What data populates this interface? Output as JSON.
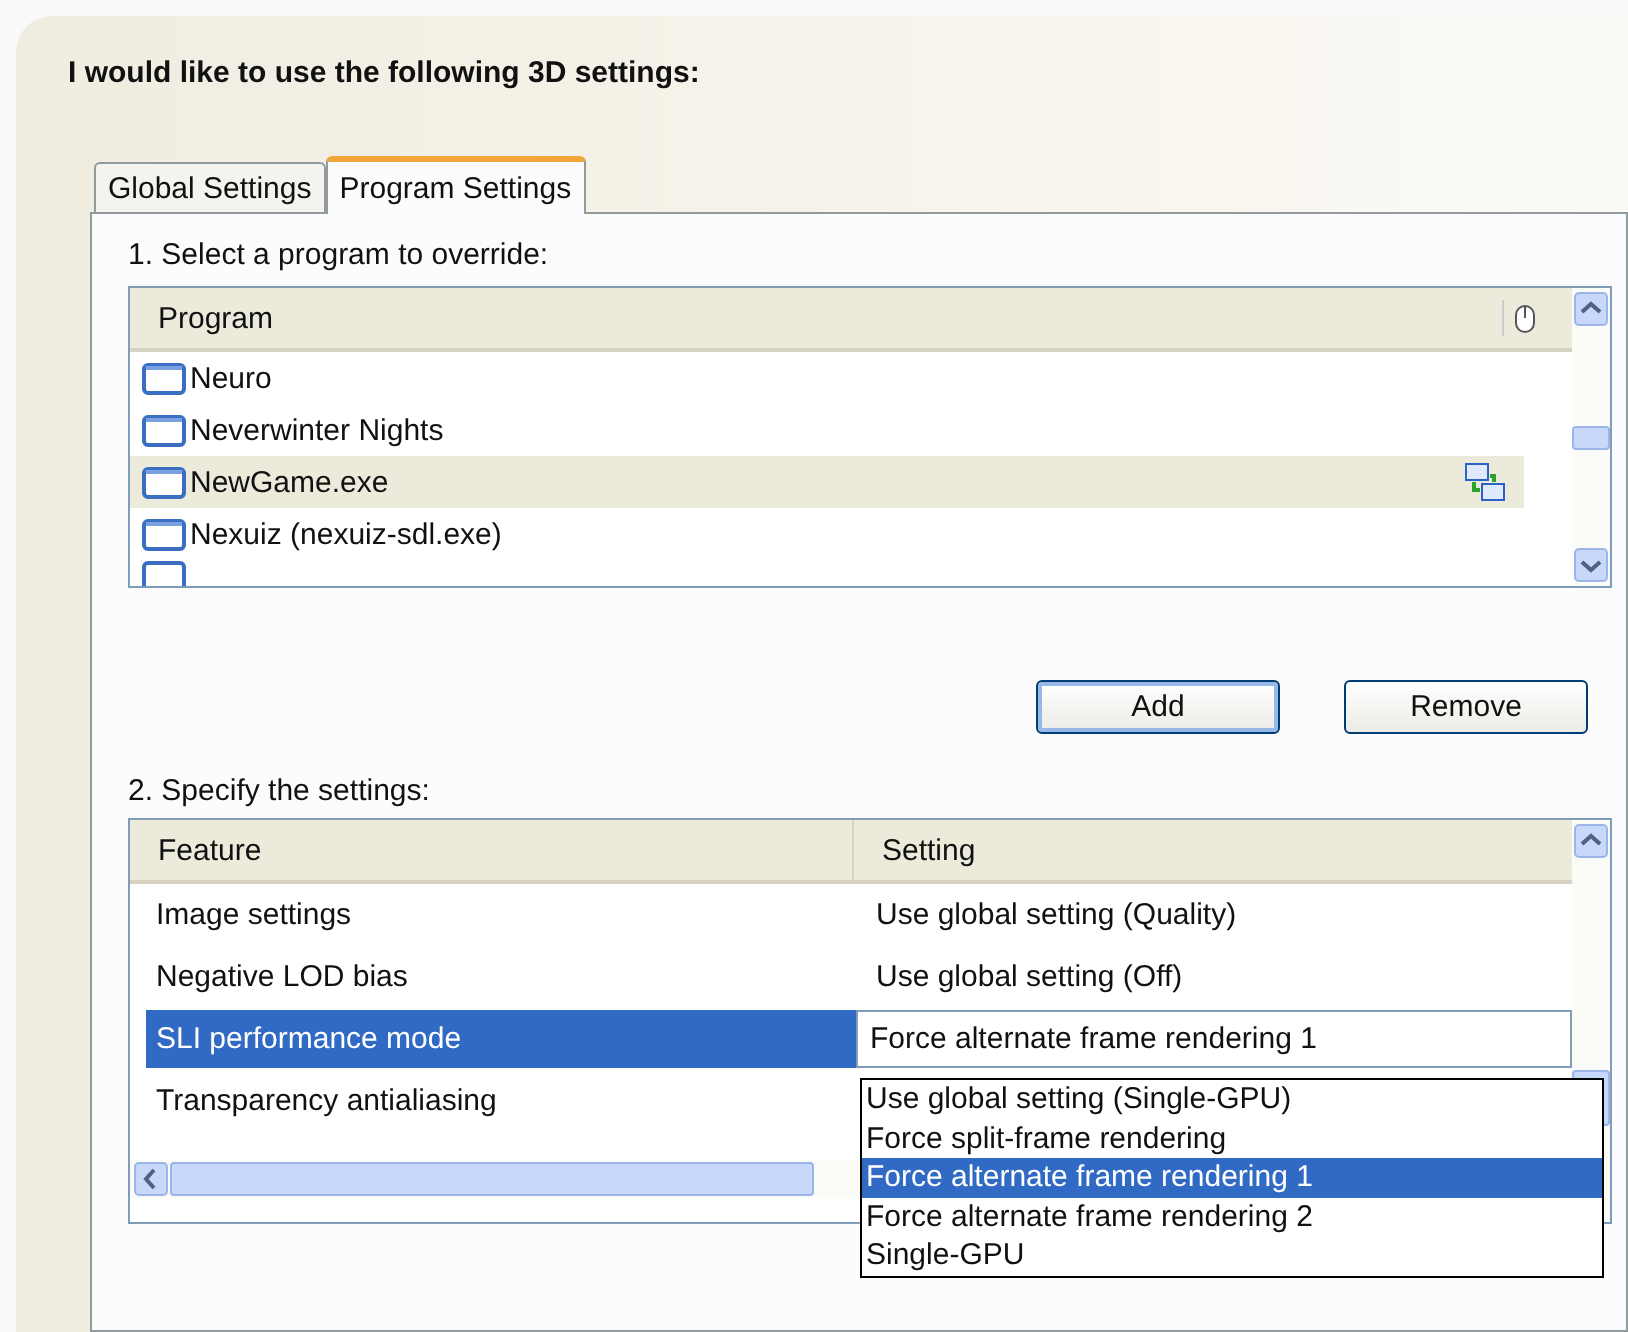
{
  "heading": "I would like to use the following 3D settings:",
  "tabs": [
    {
      "label": "Global Settings",
      "selected": false
    },
    {
      "label": "Program Settings",
      "selected": true
    }
  ],
  "program_section": {
    "label": "1. Select a program to override:",
    "columns": [
      "Program"
    ],
    "rows": [
      {
        "name": "Neuro",
        "selected": false,
        "has_profile": false
      },
      {
        "name": "Neverwinter Nights",
        "selected": false,
        "has_profile": false
      },
      {
        "name": "NewGame.exe",
        "selected": true,
        "has_profile": true
      },
      {
        "name": "Nexuiz (nexuiz-sdl.exe)",
        "selected": false,
        "has_profile": false
      }
    ]
  },
  "buttons": [
    "Add",
    "Remove"
  ],
  "settings_section": {
    "label": "2. Specify the settings:",
    "columns": [
      "Feature",
      "Setting"
    ],
    "rows": [
      {
        "feature": "Image settings",
        "setting": "Use global setting (Quality)",
        "selected": false
      },
      {
        "feature": "Negative LOD bias",
        "setting": "Use global setting (Off)",
        "selected": false
      },
      {
        "feature": "SLI performance mode",
        "setting": "Force alternate frame rendering 1",
        "selected": true
      },
      {
        "feature": "Transparency antialiasing",
        "selected": false
      }
    ],
    "dropdown": [
      {
        "label": "Use global setting (Single-GPU)",
        "selected": false
      },
      {
        "label": "Force split-frame rendering",
        "selected": false
      },
      {
        "label": "Force alternate frame rendering 1",
        "selected": true
      },
      {
        "label": "Force alternate frame rendering 2",
        "selected": false
      },
      {
        "label": "Single-GPU",
        "selected": false
      }
    ]
  }
}
